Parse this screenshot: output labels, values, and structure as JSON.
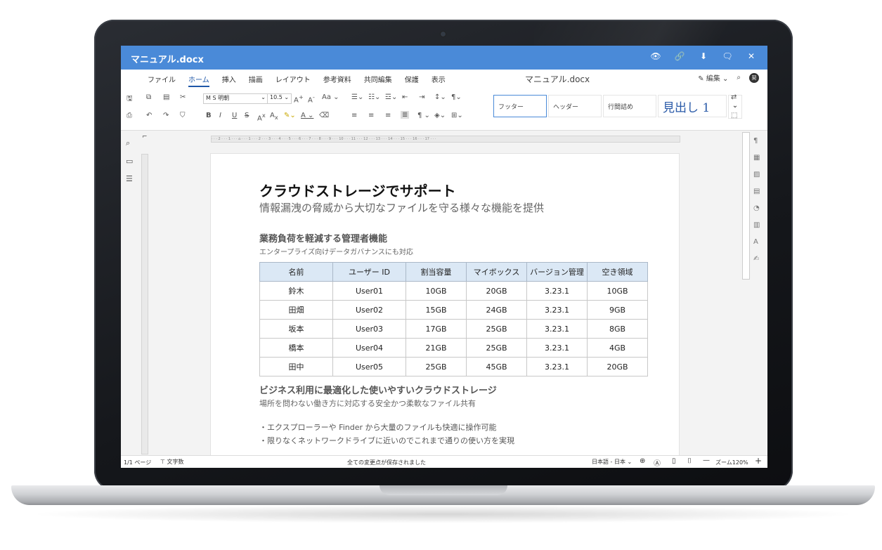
{
  "window": {
    "title": "マニュアル.docx",
    "title_icons": [
      "eye-icon",
      "link-icon",
      "download-icon",
      "comment-icon",
      "close-icon"
    ],
    "accent_color": "#4a8ad8"
  },
  "menubar": {
    "items": [
      "ファイル",
      "ホーム",
      "挿入",
      "描画",
      "レイアウト",
      "参考資料",
      "共同編集",
      "保護",
      "表示"
    ],
    "active": "ホーム",
    "center_title": "マニュアル.docx",
    "edit_label": "編集",
    "avatar_text": "契"
  },
  "toolbar": {
    "font_name": "M S 明朝",
    "font_size": "10.5",
    "styles": [
      "フッター",
      "ヘッダー",
      "行間詰め",
      "見出し 1"
    ]
  },
  "document": {
    "title": "クラウドストレージでサポート",
    "subtitle": "情報漏洩の脅威から大切なファイルを守る様々な機能を提供",
    "section1": {
      "title": "業務負荷を軽減する管理者機能",
      "subtitle": "エンタープライズ向けデータガバナンスにも対応"
    },
    "table": {
      "headers": [
        "名前",
        "ユーザー ID",
        "割当容量",
        "マイボックス",
        "バージョン管理",
        "空き領域"
      ],
      "rows": [
        [
          "鈴木",
          "User01",
          "10GB",
          "20GB",
          "3.23.1",
          "10GB"
        ],
        [
          "田畑",
          "User02",
          "15GB",
          "24GB",
          "3.23.1",
          "9GB"
        ],
        [
          "坂本",
          "User03",
          "17GB",
          "25GB",
          "3.23.1",
          "8GB"
        ],
        [
          "橋本",
          "User04",
          "21GB",
          "25GB",
          "3.23.1",
          "4GB"
        ],
        [
          "田中",
          "User05",
          "25GB",
          "45GB",
          "3.23.1",
          "20GB"
        ]
      ]
    },
    "section2": {
      "title": "ビジネス利用に最適化した使いやすいクラウドストレージ",
      "subtitle": "場所を問わない働き方に対応する安全かつ柔軟なファイル共有"
    },
    "bullets": [
      "・エクスプローラーや Finder から大量のファイルも快適に操作可能",
      "・限りなくネットワークドライブに近いのでこれまで通りの使い方を実現"
    ]
  },
  "statusbar": {
    "page": "1/1 ページ",
    "word_count": "文字数",
    "saved": "全ての変更点が保存されました",
    "language": "日本語 - 日本",
    "zoom_label": "ズーム120%"
  }
}
